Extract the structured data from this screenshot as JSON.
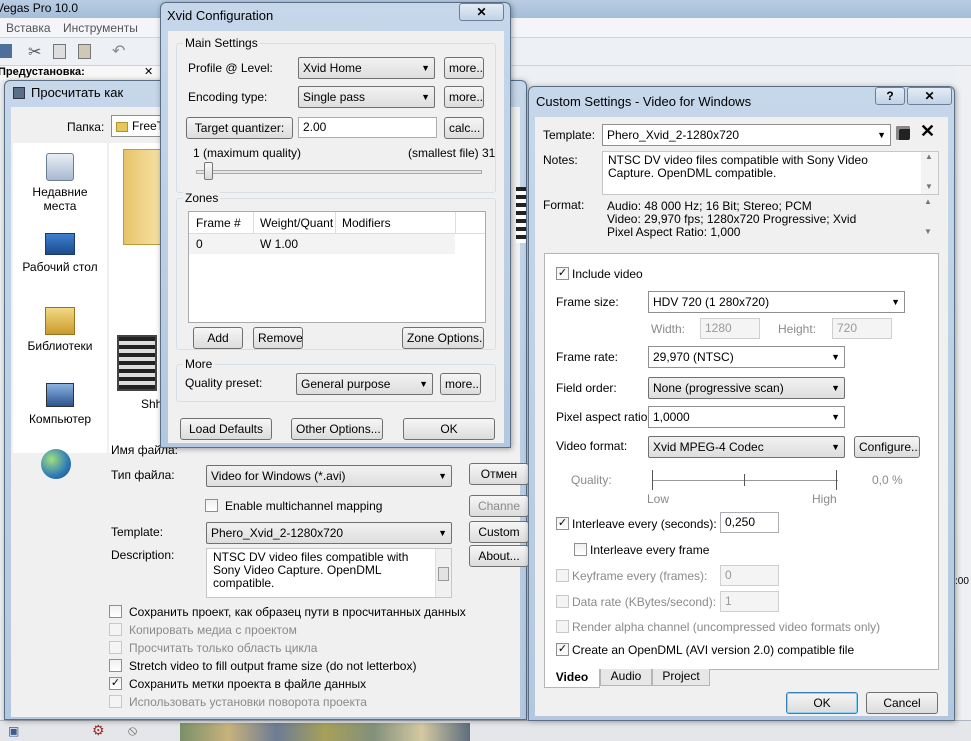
{
  "app": {
    "title": "Vegas Pro 10.0",
    "menu": [
      "Вставка",
      "Инструменты"
    ],
    "project_label": "Предустановка:"
  },
  "render_as": {
    "title": "Просчитать как",
    "folder_label": "Папка:",
    "folder_value": "FreeT",
    "places": [
      {
        "label": "Недавние места",
        "icon": "recent-places-icon"
      },
      {
        "label": "Рабочий стол",
        "icon": "desktop-icon"
      },
      {
        "label": "Библиотеки",
        "icon": "libraries-icon"
      },
      {
        "label": "Компьютер",
        "icon": "computer-icon"
      },
      {
        "label": "",
        "icon": "network-icon"
      }
    ],
    "file_item_label": "Shh",
    "filename_label": "Имя файла:",
    "filetype_label": "Тип файла:",
    "filetype_value": "Video for Windows (*.avi)",
    "multichannel_label": "Enable multichannel mapping",
    "template_label": "Template:",
    "template_value": "Phero_Xvid_2-1280x720",
    "description_label": "Description:",
    "description_value": "NTSC DV video files compatible with Sony Video Capture. OpenDML compatible.",
    "buttons": {
      "cancel": "Отмен",
      "channels": "Channe",
      "custom": "Custom",
      "about": "About..."
    },
    "options": [
      {
        "label": "Сохранить проект, как образец пути в просчитанных данных",
        "checked": false,
        "enabled": true
      },
      {
        "label": "Копировать медиа с проектом",
        "checked": false,
        "enabled": false
      },
      {
        "label": "Просчитать только область цикла",
        "checked": false,
        "enabled": false
      },
      {
        "label": "Stretch video to fill output frame size (do not letterbox)",
        "checked": false,
        "enabled": true
      },
      {
        "label": "Сохранить метки проекта в файле данных",
        "checked": true,
        "enabled": true
      },
      {
        "label": "Использовать установки поворота проекта",
        "checked": false,
        "enabled": false
      }
    ]
  },
  "xvid": {
    "title": "Xvid Configuration",
    "main_settings": "Main Settings",
    "profile_label": "Profile @ Level:",
    "profile_value": "Xvid Home",
    "encoding_label": "Encoding type:",
    "encoding_value": "Single pass",
    "more": "more...",
    "target_button": "Target quantizer:",
    "target_value": "2.00",
    "calc": "calc...",
    "slider_min": "1 (maximum quality)",
    "slider_max": "(smallest file) 31",
    "zones_label": "Zones",
    "zones_columns": [
      "Frame #",
      "Weight/Quant",
      "Modifiers"
    ],
    "zones_rows": [
      [
        "0",
        "W 1.00",
        ""
      ]
    ],
    "add": "Add",
    "remove": "Remove",
    "zone_options": "Zone Options...",
    "more_label": "More",
    "quality_preset_label": "Quality preset:",
    "quality_preset_value": "General purpose",
    "load_defaults": "Load Defaults",
    "other_options": "Other Options...",
    "ok": "OK"
  },
  "custom": {
    "title": "Custom Settings - Video for Windows",
    "help": "?",
    "template_label": "Template:",
    "template_value": "Phero_Xvid_2-1280x720",
    "notes_label": "Notes:",
    "notes_value": "NTSC DV video files compatible with Sony Video Capture. OpenDML compatible.",
    "format_label": "Format:",
    "format_lines": [
      "Audio: 48 000 Hz; 16 Bit; Stereo; PCM",
      "Video: 29,970 fps; 1280x720 Progressive; Xvid",
      "Pixel Aspect Ratio: 1,000"
    ],
    "include_video": "Include video",
    "frame_size_label": "Frame size:",
    "frame_size_value": "HDV 720 (1 280x720)",
    "width_label": "Width:",
    "width_value": "1280",
    "height_label": "Height:",
    "height_value": "720",
    "frame_rate_label": "Frame rate:",
    "frame_rate_value": "29,970 (NTSC)",
    "field_order_label": "Field order:",
    "field_order_value": "None (progressive scan)",
    "par_label": "Pixel aspect ratio:",
    "par_value": "1,0000",
    "video_format_label": "Video format:",
    "video_format_value": "Xvid MPEG-4 Codec",
    "configure": "Configure...",
    "quality_label": "Quality:",
    "quality_value": "0,0 %",
    "low": "Low",
    "high": "High",
    "interleave_label": "Interleave every (seconds):",
    "interleave_value": "0,250",
    "interleave_frame_label": "Interleave every frame",
    "keyframe_label": "Keyframe every (frames):",
    "keyframe_value": "0",
    "datarate_label": "Data rate (KBytes/second):",
    "datarate_value": "1",
    "alpha_label": "Render alpha channel (uncompressed video formats only)",
    "opendml_label": "Create an OpenDML (AVI version 2.0) compatible file",
    "tabs": [
      "Video",
      "Audio",
      "Project"
    ],
    "ok": "OK",
    "cancel": "Cancel"
  }
}
